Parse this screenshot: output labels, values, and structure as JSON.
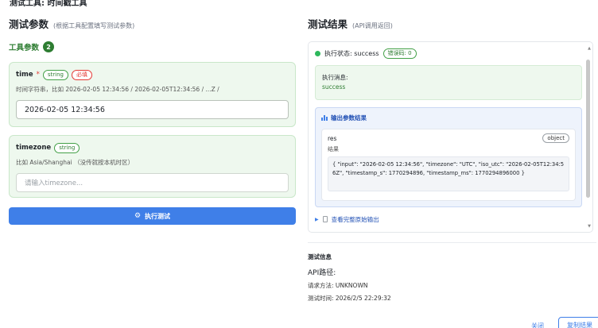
{
  "window": {
    "title": "测试工具: 时间戳工具"
  },
  "test_params": {
    "title": "测试参数",
    "subtitle": "(根据工具配置填写测试参数)",
    "tool_params_label": "工具参数",
    "tool_params_count": "2",
    "params": [
      {
        "name": "time",
        "required_mark": "*",
        "type": "string",
        "required_tag": "必填",
        "description": "时间字符串，比如 2026-02-05 12:34:56 / 2026-02-05T12:34:56 / ...Z /",
        "value": "2026-02-05 12:34:56"
      },
      {
        "name": "timezone",
        "type": "string",
        "description": "比如 Asia/Shanghai （没传就按本机时区）",
        "placeholder": "请输入timezone..."
      }
    ],
    "run_button": "执行测试"
  },
  "test_result": {
    "title": "测试结果",
    "subtitle": "(API调用返回)",
    "status_text": "执行状态: success",
    "error_code": "错误码: 0",
    "status_color": "#2eb85c",
    "message_label": "执行消息:",
    "message_value": "success",
    "output_title": "输出参数结果",
    "output": {
      "name": "res",
      "type": "object",
      "description": "结果",
      "value": "{ \"input\": \"2026-02-05 12:34:56\", \"timezone\": \"UTC\", \"iso_utc\": \"2026-02-05T12:34:56Z\", \"timestamp_s\": 1770294896, \"timestamp_ms\": 1770294896000 }"
    },
    "raw_output_link": "查看完整原始输出"
  },
  "test_info": {
    "title": "测试信息",
    "api_path": "API路径:",
    "request_method": "请求方法: UNKNOWN",
    "test_time": "测试时间: 2026/2/5 22:29:32"
  },
  "footer": {
    "close": "关闭",
    "copy": "复制结果"
  },
  "colors": {
    "accent": "#3f7fe8",
    "success": "#2e7d32",
    "danger": "#e53935"
  }
}
